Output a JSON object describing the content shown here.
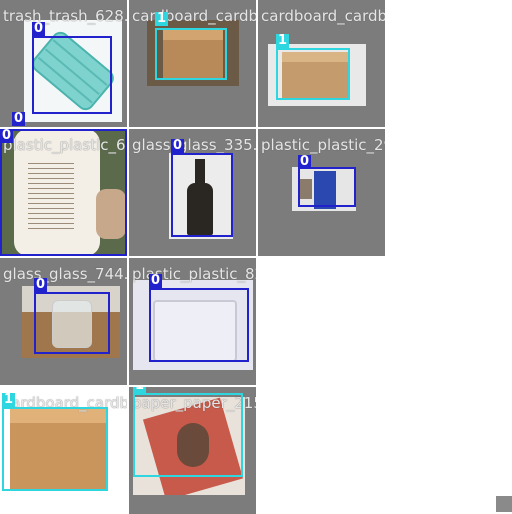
{
  "tiles": [
    {
      "file": "trash_trash_628.jpg",
      "label": "0"
    },
    {
      "file": "cardboard_cardboard_161.jpg",
      "label": "1"
    },
    {
      "file": "cardboard_cardboard_1583.jpg",
      "label": "1"
    },
    {
      "file": "plastic_plastic_636.jpg",
      "label": "0"
    },
    {
      "file": "glass_glass_335.jpg",
      "label": "0"
    },
    {
      "file": "plastic_plastic_293.jpg",
      "label": "0"
    },
    {
      "file": "glass_glass_744.jpg",
      "label": "0"
    },
    {
      "file": "plastic_plastic_821.jpg",
      "label": "0"
    },
    {
      "file": "cardboard_cardboard_8.jpg",
      "label": "1"
    },
    {
      "file": "paper_paper_2152.jpg",
      "label": "1"
    }
  ],
  "colors": {
    "class0": "#2222cc",
    "class1": "#2ed6e0",
    "tile_bg": "#7c7c7c"
  }
}
